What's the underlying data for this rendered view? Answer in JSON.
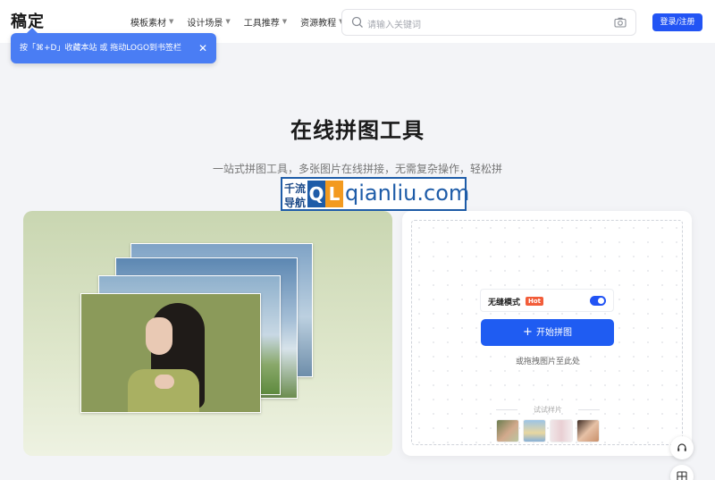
{
  "header": {
    "logo": "稿定",
    "nav": [
      {
        "label": "模板素材"
      },
      {
        "label": "设计场景"
      },
      {
        "label": "工具推荐"
      },
      {
        "label": "资源教程"
      }
    ],
    "search_placeholder": "请输入关键词",
    "login_label": "登录/注册"
  },
  "tooltip": {
    "text": "按「⌘+D」收藏本站 或 拖动LOGO到书签栏"
  },
  "hero": {
    "title": "在线拼图工具",
    "subtitle": "一站式拼图工具，多张图片在线拼接，无需复杂操作，轻松拼"
  },
  "watermark": {
    "line1": "千流",
    "line2": "导航",
    "q": "Q",
    "l": "L",
    "domain": "qianliu.com"
  },
  "upload": {
    "mode_label": "无缝模式",
    "hot_badge": "Hot",
    "start_label": "开始拼图",
    "drop_hint": "或拖拽图片至此处",
    "sample_title": "试试样片"
  },
  "colors": {
    "accent": "#2254f4",
    "tooltip_bg": "#4a7df4",
    "hot": "#f25d3a"
  }
}
